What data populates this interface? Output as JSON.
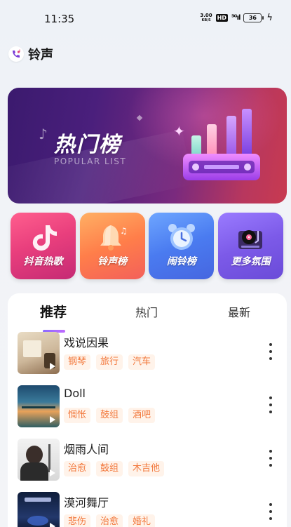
{
  "status_bar": {
    "time": "11:35",
    "net_speed_value": "3.00",
    "net_speed_unit": "KB/S",
    "hd": "HD",
    "signal": "⁵ᴳıl",
    "battery": "36"
  },
  "header": {
    "title": "铃声",
    "logo_icon": "phone-music-icon"
  },
  "banner": {
    "title": "热门榜",
    "subtitle": "POPULAR LIST"
  },
  "categories": [
    {
      "label": "抖音热歌",
      "icon": "tiktok-note-icon"
    },
    {
      "label": "铃声榜",
      "icon": "bell-icon"
    },
    {
      "label": "闹铃榜",
      "icon": "alarm-clock-icon"
    },
    {
      "label": "更多氛围",
      "icon": "record-player-icon"
    }
  ],
  "tabs": [
    {
      "label": "推荐",
      "active": true
    },
    {
      "label": "热门",
      "active": false
    },
    {
      "label": "最新",
      "active": false
    }
  ],
  "songs": [
    {
      "title": "戏说因果",
      "tags": [
        "钢琴",
        "旅行",
        "汽车"
      ]
    },
    {
      "title": "Doll",
      "tags": [
        "惆怅",
        "鼓组",
        "酒吧"
      ]
    },
    {
      "title": "烟雨人间",
      "tags": [
        "治愈",
        "鼓组",
        "木吉他"
      ]
    },
    {
      "title": "漠河舞厅",
      "tags": [
        "悲伤",
        "治愈",
        "婚礼"
      ]
    }
  ],
  "colors": {
    "tag_bg": "#fff3ea",
    "tag_text": "#f2783c",
    "accent": "#8a6bff"
  }
}
